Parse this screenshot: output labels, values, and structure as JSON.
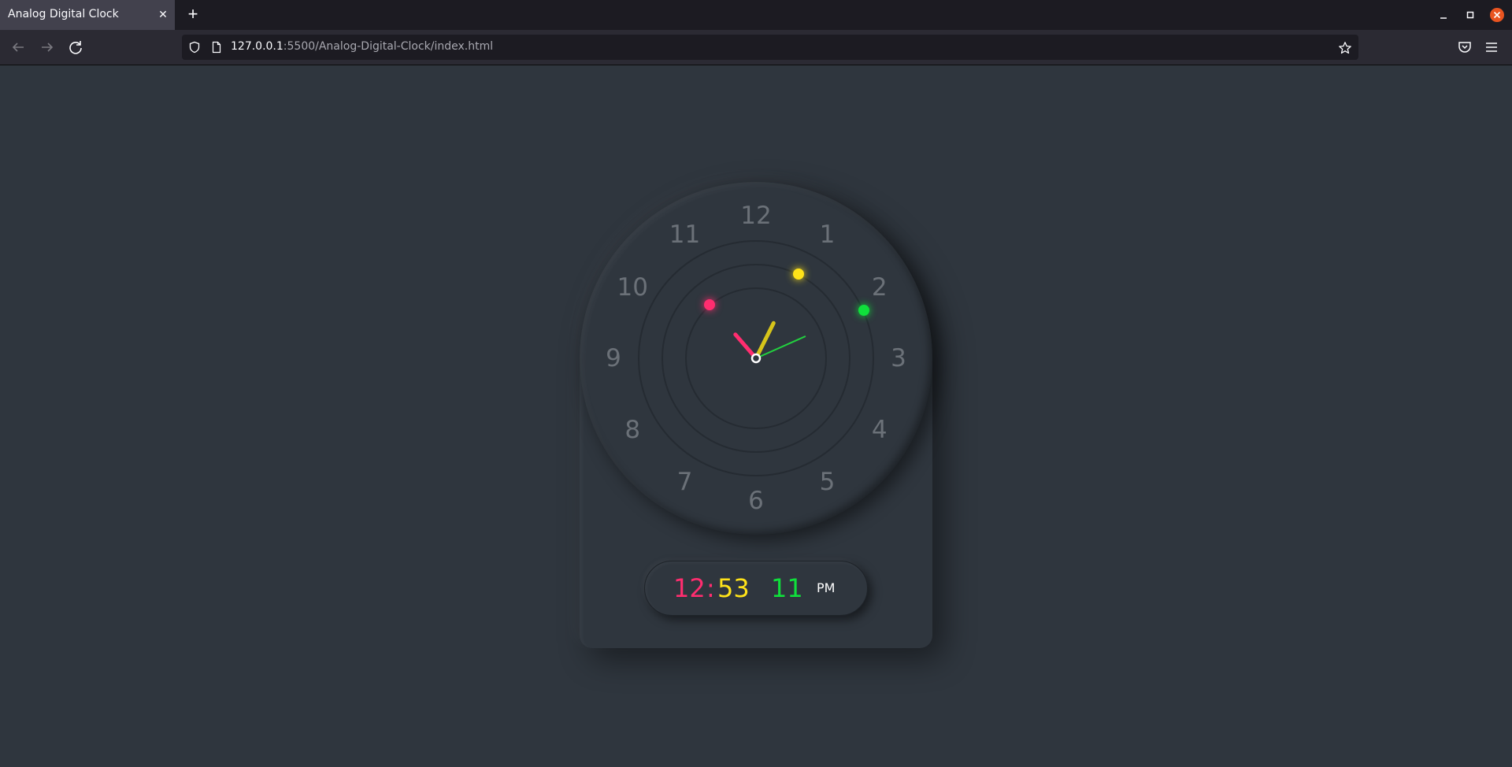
{
  "browser": {
    "tab_title": "Analog Digital Clock",
    "new_tab_label": "+",
    "url_host": "127.0.0.1",
    "url_rest": ":5500/Analog-Digital-Clock/index.html"
  },
  "colors": {
    "hour": "#d6c41a",
    "minute": "#ff2d6f",
    "second": "#22d13f",
    "hour_dot": "#ffe319",
    "minute_dot": "#ff2d6f",
    "second_dot": "#0fe03b",
    "am_pm": "#ffffff"
  },
  "clock": {
    "numbers": [
      "12",
      "1",
      "2",
      "3",
      "4",
      "5",
      "6",
      "7",
      "8",
      "9",
      "10",
      "11"
    ],
    "time": {
      "hour": 12,
      "minute": 53,
      "second": 11
    }
  },
  "digital": {
    "hour": "12",
    "colon": ":",
    "minute": "53",
    "second": "11",
    "ampm": "PM"
  }
}
